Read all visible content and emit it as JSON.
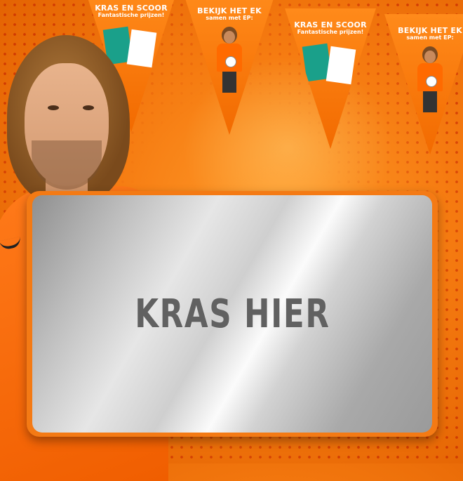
{
  "scratch_card": {
    "label": "KRAS HIER"
  },
  "pennants": [
    {
      "line1": "Kras en scoor",
      "line2": "Fantastische prijzen!"
    },
    {
      "line1": "Bekijk het EK",
      "line2": "samen met EP:"
    },
    {
      "line1": "Kras en scoor",
      "line2": "Fantastische prijzen!"
    },
    {
      "line1": "Bekijk het EK",
      "line2": "samen met EP:"
    }
  ],
  "colors": {
    "background": "#f57a10",
    "card_frame": "#f47a14",
    "scratch_text": "#616161"
  }
}
